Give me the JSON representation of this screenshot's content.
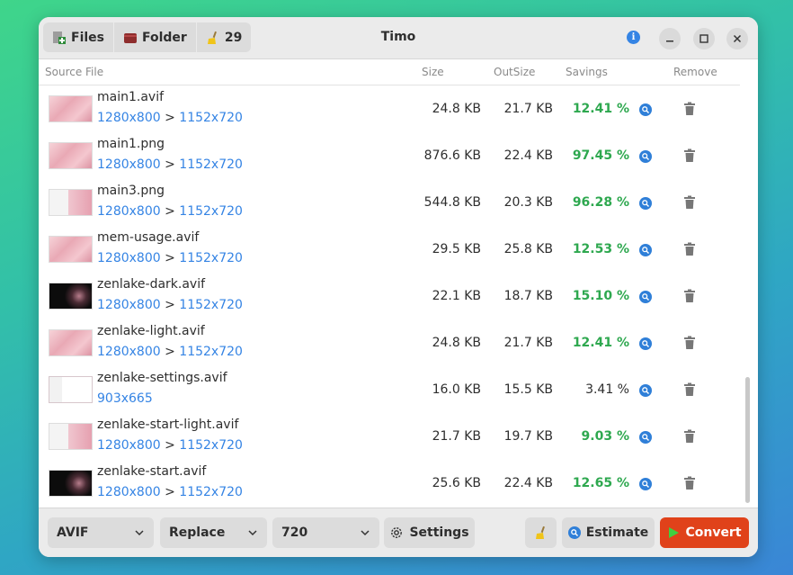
{
  "window": {
    "title": "Timo"
  },
  "toolbar": {
    "files_label": "Files",
    "folder_label": "Folder",
    "clean_count": "29"
  },
  "columns": {
    "source": "Source File",
    "size": "Size",
    "outsize": "OutSize",
    "savings": "Savings",
    "remove": "Remove"
  },
  "files": [
    {
      "name": "main1.avif",
      "orig_dims": "1280x800",
      "new_dims": "1152x720",
      "size": "24.8 KB",
      "outsize": "21.7 KB",
      "savings": "12.41 %",
      "savings_good": true,
      "thumb": "light"
    },
    {
      "name": "main1.png",
      "orig_dims": "1280x800",
      "new_dims": "1152x720",
      "size": "876.6 KB",
      "outsize": "22.4 KB",
      "savings": "97.45 %",
      "savings_good": true,
      "thumb": "light"
    },
    {
      "name": "main3.png",
      "orig_dims": "1280x800",
      "new_dims": "1152x720",
      "size": "544.8 KB",
      "outsize": "20.3 KB",
      "savings": "96.28 %",
      "savings_good": true,
      "thumb": "shot"
    },
    {
      "name": "mem-usage.avif",
      "orig_dims": "1280x800",
      "new_dims": "1152x720",
      "size": "29.5 KB",
      "outsize": "25.8 KB",
      "savings": "12.53 %",
      "savings_good": true,
      "thumb": "light"
    },
    {
      "name": "zenlake-dark.avif",
      "orig_dims": "1280x800",
      "new_dims": "1152x720",
      "size": "22.1 KB",
      "outsize": "18.7 KB",
      "savings": "15.10 %",
      "savings_good": true,
      "thumb": "dark"
    },
    {
      "name": "zenlake-light.avif",
      "orig_dims": "1280x800",
      "new_dims": "1152x720",
      "size": "24.8 KB",
      "outsize": "21.7 KB",
      "savings": "12.41 %",
      "savings_good": true,
      "thumb": "light"
    },
    {
      "name": "zenlake-settings.avif",
      "orig_dims": "903x665",
      "new_dims": "",
      "size": "16.0 KB",
      "outsize": "15.5 KB",
      "savings": "3.41 %",
      "savings_good": false,
      "thumb": "settings"
    },
    {
      "name": "zenlake-start-light.avif",
      "orig_dims": "1280x800",
      "new_dims": "1152x720",
      "size": "21.7 KB",
      "outsize": "19.7 KB",
      "savings": "9.03 %",
      "savings_good": true,
      "thumb": "shot"
    },
    {
      "name": "zenlake-start.avif",
      "orig_dims": "1280x800",
      "new_dims": "1152x720",
      "size": "25.6 KB",
      "outsize": "22.4 KB",
      "savings": "12.65 %",
      "savings_good": true,
      "thumb": "dark"
    }
  ],
  "footer": {
    "format_value": "AVIF",
    "mode_value": "Replace",
    "resolution_value": "720",
    "settings_label": "Settings",
    "estimate_label": "Estimate",
    "convert_label": "Convert"
  },
  "colors": {
    "accent": "#3584e4",
    "savings_good": "#2ea84f",
    "convert": "#e0421a"
  },
  "icons": [
    "add-file-icon",
    "folder-icon",
    "broom-icon",
    "info-icon",
    "minimize-icon",
    "maximize-icon",
    "close-icon",
    "zoom-icon",
    "trash-icon",
    "chevron-down-icon",
    "gear-icon",
    "play-icon"
  ]
}
